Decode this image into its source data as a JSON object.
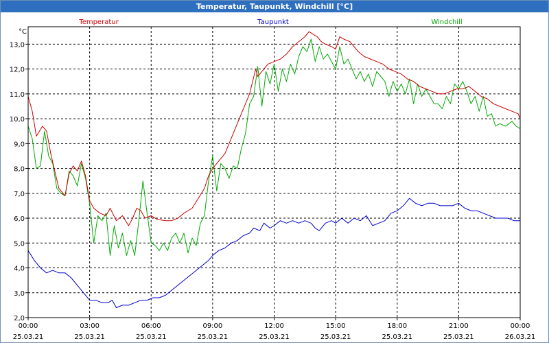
{
  "window": {
    "title": "Temperatur, Taupunkt, Windchill [°C]"
  },
  "chart_data": {
    "type": "line",
    "title": "Temperatur, Taupunkt, Windchill [°C]",
    "ylabel": "°C",
    "ylim": [
      2.0,
      13.7
    ],
    "yticks": [
      "2,0",
      "3,0",
      "4,0",
      "5,0",
      "6,0",
      "7,0",
      "8,0",
      "9,0",
      "10,0",
      "11,0",
      "12,0",
      "13,0"
    ],
    "yticks_values": [
      2,
      3,
      4,
      5,
      6,
      7,
      8,
      9,
      10,
      11,
      12,
      13
    ],
    "xlim_hours": [
      0,
      24
    ],
    "xticks": [
      {
        "time": "00:00",
        "date": "25.03.21",
        "hour": 0
      },
      {
        "time": "03:00",
        "date": "25.03.21",
        "hour": 3
      },
      {
        "time": "06:00",
        "date": "25.03.21",
        "hour": 6
      },
      {
        "time": "09:00",
        "date": "25.03.21",
        "hour": 9
      },
      {
        "time": "12:00",
        "date": "25.03.21",
        "hour": 12
      },
      {
        "time": "15:00",
        "date": "25.03.21",
        "hour": 15
      },
      {
        "time": "18:00",
        "date": "25.03.21",
        "hour": 18
      },
      {
        "time": "21:00",
        "date": "25.03.21",
        "hour": 21
      },
      {
        "time": "00:00",
        "date": "26.03.21",
        "hour": 24
      }
    ],
    "grid": true,
    "legend_position": "top",
    "series": [
      {
        "name": "Temperatur",
        "color": "#cc0000",
        "points": [
          [
            0,
            10.9
          ],
          [
            0.2,
            10.3
          ],
          [
            0.4,
            9.3
          ],
          [
            0.7,
            9.7
          ],
          [
            0.9,
            9.5
          ],
          [
            1.1,
            8.6
          ],
          [
            1.3,
            7.9
          ],
          [
            1.5,
            7.2
          ],
          [
            1.8,
            6.9
          ],
          [
            2.0,
            7.8
          ],
          [
            2.2,
            8.1
          ],
          [
            2.4,
            7.9
          ],
          [
            2.6,
            8.3
          ],
          [
            2.8,
            7.7
          ],
          [
            3.0,
            6.7
          ],
          [
            3.2,
            6.4
          ],
          [
            3.5,
            6.2
          ],
          [
            3.8,
            6.1
          ],
          [
            4.0,
            6.4
          ],
          [
            4.3,
            5.9
          ],
          [
            4.6,
            6.1
          ],
          [
            4.9,
            5.7
          ],
          [
            5.1,
            6.0
          ],
          [
            5.3,
            6.4
          ],
          [
            5.5,
            6.3
          ],
          [
            5.7,
            6.0
          ],
          [
            6.0,
            6.1
          ],
          [
            6.3,
            5.95
          ],
          [
            6.7,
            5.9
          ],
          [
            7.0,
            5.9
          ],
          [
            7.3,
            6.0
          ],
          [
            7.6,
            6.2
          ],
          [
            8.0,
            6.4
          ],
          [
            8.3,
            6.8
          ],
          [
            8.6,
            7.2
          ],
          [
            8.8,
            7.7
          ],
          [
            9.0,
            8.0
          ],
          [
            9.3,
            8.3
          ],
          [
            9.6,
            8.6
          ],
          [
            9.9,
            9.2
          ],
          [
            10.2,
            9.8
          ],
          [
            10.5,
            10.4
          ],
          [
            10.8,
            11.0
          ],
          [
            11.1,
            12.0
          ],
          [
            11.2,
            11.7
          ],
          [
            11.4,
            11.9
          ],
          [
            11.7,
            12.2
          ],
          [
            12.0,
            12.3
          ],
          [
            12.3,
            12.4
          ],
          [
            12.6,
            12.6
          ],
          [
            12.9,
            12.9
          ],
          [
            13.2,
            13.1
          ],
          [
            13.5,
            13.3
          ],
          [
            13.7,
            13.5
          ],
          [
            13.9,
            13.4
          ],
          [
            14.1,
            13.3
          ],
          [
            14.3,
            13.1
          ],
          [
            14.5,
            13.0
          ],
          [
            14.8,
            12.9
          ],
          [
            15.0,
            12.8
          ],
          [
            15.2,
            13.3
          ],
          [
            15.4,
            13.2
          ],
          [
            15.7,
            13.1
          ],
          [
            15.9,
            12.9
          ],
          [
            16.1,
            12.7
          ],
          [
            16.4,
            12.5
          ],
          [
            16.7,
            12.4
          ],
          [
            17.0,
            12.3
          ],
          [
            17.3,
            12.2
          ],
          [
            17.6,
            12.0
          ],
          [
            17.9,
            11.9
          ],
          [
            18.2,
            11.8
          ],
          [
            18.5,
            11.6
          ],
          [
            18.8,
            11.5
          ],
          [
            19.1,
            11.3
          ],
          [
            19.4,
            11.2
          ],
          [
            19.7,
            11.1
          ],
          [
            20.0,
            11.0
          ],
          [
            20.3,
            11.0
          ],
          [
            20.6,
            11.1
          ],
          [
            20.9,
            11.2
          ],
          [
            21.2,
            11.2
          ],
          [
            21.5,
            11.3
          ],
          [
            21.8,
            11.1
          ],
          [
            22.1,
            10.9
          ],
          [
            22.4,
            10.8
          ],
          [
            22.7,
            10.6
          ],
          [
            23.0,
            10.5
          ],
          [
            23.3,
            10.4
          ],
          [
            23.6,
            10.3
          ],
          [
            23.9,
            10.2
          ],
          [
            24.0,
            10.0
          ]
        ]
      },
      {
        "name": "Taupunkt",
        "color": "#0000cc",
        "points": [
          [
            0,
            4.7
          ],
          [
            0.3,
            4.3
          ],
          [
            0.6,
            4.0
          ],
          [
            0.9,
            3.8
          ],
          [
            1.2,
            3.9
          ],
          [
            1.5,
            3.8
          ],
          [
            1.8,
            3.8
          ],
          [
            2.1,
            3.6
          ],
          [
            2.4,
            3.3
          ],
          [
            2.7,
            3.0
          ],
          [
            3.0,
            2.7
          ],
          [
            3.3,
            2.7
          ],
          [
            3.6,
            2.6
          ],
          [
            3.9,
            2.6
          ],
          [
            4.1,
            2.7
          ],
          [
            4.3,
            2.4
          ],
          [
            4.6,
            2.5
          ],
          [
            4.9,
            2.5
          ],
          [
            5.2,
            2.6
          ],
          [
            5.5,
            2.7
          ],
          [
            5.8,
            2.7
          ],
          [
            6.1,
            2.8
          ],
          [
            6.4,
            2.8
          ],
          [
            6.7,
            2.9
          ],
          [
            7.0,
            3.1
          ],
          [
            7.3,
            3.3
          ],
          [
            7.6,
            3.5
          ],
          [
            7.9,
            3.7
          ],
          [
            8.2,
            3.9
          ],
          [
            8.5,
            4.1
          ],
          [
            8.8,
            4.3
          ],
          [
            9.0,
            4.5
          ],
          [
            9.3,
            4.7
          ],
          [
            9.6,
            4.8
          ],
          [
            9.9,
            5.0
          ],
          [
            10.2,
            5.1
          ],
          [
            10.5,
            5.3
          ],
          [
            10.8,
            5.4
          ],
          [
            11.0,
            5.6
          ],
          [
            11.3,
            5.5
          ],
          [
            11.5,
            5.8
          ],
          [
            11.8,
            5.6
          ],
          [
            12.0,
            5.7
          ],
          [
            12.3,
            5.9
          ],
          [
            12.6,
            5.8
          ],
          [
            12.9,
            5.9
          ],
          [
            13.2,
            5.8
          ],
          [
            13.5,
            5.9
          ],
          [
            13.8,
            5.8
          ],
          [
            14.0,
            5.6
          ],
          [
            14.2,
            5.5
          ],
          [
            14.5,
            5.8
          ],
          [
            14.8,
            5.9
          ],
          [
            15.0,
            5.8
          ],
          [
            15.3,
            6.0
          ],
          [
            15.6,
            5.8
          ],
          [
            15.9,
            6.0
          ],
          [
            16.2,
            5.9
          ],
          [
            16.5,
            6.1
          ],
          [
            16.8,
            5.7
          ],
          [
            17.1,
            5.8
          ],
          [
            17.4,
            5.9
          ],
          [
            17.7,
            6.2
          ],
          [
            18.0,
            6.3
          ],
          [
            18.3,
            6.5
          ],
          [
            18.6,
            6.8
          ],
          [
            18.9,
            6.6
          ],
          [
            19.2,
            6.5
          ],
          [
            19.5,
            6.6
          ],
          [
            19.8,
            6.6
          ],
          [
            20.1,
            6.5
          ],
          [
            20.4,
            6.5
          ],
          [
            20.7,
            6.5
          ],
          [
            21.0,
            6.6
          ],
          [
            21.3,
            6.4
          ],
          [
            21.6,
            6.3
          ],
          [
            21.9,
            6.3
          ],
          [
            22.2,
            6.2
          ],
          [
            22.5,
            6.1
          ],
          [
            22.8,
            6.0
          ],
          [
            23.1,
            6.0
          ],
          [
            23.4,
            6.0
          ],
          [
            23.7,
            5.9
          ],
          [
            24.0,
            5.9
          ]
        ]
      },
      {
        "name": "Windchill",
        "color": "#00aa00",
        "points": [
          [
            0,
            9.7
          ],
          [
            0.2,
            9.2
          ],
          [
            0.4,
            8.0
          ],
          [
            0.6,
            8.1
          ],
          [
            0.8,
            9.5
          ],
          [
            1.0,
            8.5
          ],
          [
            1.2,
            8.2
          ],
          [
            1.4,
            7.2
          ],
          [
            1.6,
            7.0
          ],
          [
            1.8,
            6.9
          ],
          [
            2.0,
            7.9
          ],
          [
            2.2,
            7.7
          ],
          [
            2.4,
            7.3
          ],
          [
            2.6,
            8.2
          ],
          [
            2.8,
            7.6
          ],
          [
            3.0,
            6.6
          ],
          [
            3.2,
            5.0
          ],
          [
            3.4,
            6.1
          ],
          [
            3.6,
            5.9
          ],
          [
            3.8,
            6.2
          ],
          [
            4.0,
            4.5
          ],
          [
            4.2,
            5.7
          ],
          [
            4.4,
            4.8
          ],
          [
            4.6,
            5.4
          ],
          [
            4.8,
            4.5
          ],
          [
            5.0,
            5.1
          ],
          [
            5.2,
            4.5
          ],
          [
            5.4,
            5.9
          ],
          [
            5.6,
            7.5
          ],
          [
            5.8,
            6.2
          ],
          [
            6.0,
            5.0
          ],
          [
            6.2,
            4.9
          ],
          [
            6.4,
            4.7
          ],
          [
            6.6,
            5.0
          ],
          [
            6.8,
            4.7
          ],
          [
            7.0,
            5.2
          ],
          [
            7.2,
            5.4
          ],
          [
            7.4,
            5.0
          ],
          [
            7.6,
            5.4
          ],
          [
            7.8,
            4.6
          ],
          [
            8.0,
            5.2
          ],
          [
            8.2,
            4.9
          ],
          [
            8.4,
            5.8
          ],
          [
            8.6,
            6.1
          ],
          [
            8.8,
            7.5
          ],
          [
            9.0,
            8.5
          ],
          [
            9.2,
            7.1
          ],
          [
            9.4,
            8.2
          ],
          [
            9.6,
            8.0
          ],
          [
            9.8,
            7.6
          ],
          [
            10.0,
            8.1
          ],
          [
            10.2,
            8.0
          ],
          [
            10.4,
            8.8
          ],
          [
            10.6,
            9.4
          ],
          [
            10.8,
            10.6
          ],
          [
            11.0,
            10.9
          ],
          [
            11.2,
            12.1
          ],
          [
            11.4,
            10.5
          ],
          [
            11.6,
            11.9
          ],
          [
            11.8,
            11.4
          ],
          [
            12.0,
            12.2
          ],
          [
            12.2,
            11.1
          ],
          [
            12.4,
            12.0
          ],
          [
            12.6,
            11.5
          ],
          [
            12.8,
            12.2
          ],
          [
            13.0,
            11.8
          ],
          [
            13.2,
            12.5
          ],
          [
            13.4,
            12.9
          ],
          [
            13.6,
            12.7
          ],
          [
            13.8,
            13.2
          ],
          [
            14.0,
            12.3
          ],
          [
            14.2,
            12.9
          ],
          [
            14.4,
            12.4
          ],
          [
            14.6,
            12.6
          ],
          [
            14.8,
            12.3
          ],
          [
            15.0,
            12.0
          ],
          [
            15.2,
            12.9
          ],
          [
            15.4,
            12.2
          ],
          [
            15.6,
            12.4
          ],
          [
            15.8,
            12.0
          ],
          [
            16.0,
            11.6
          ],
          [
            16.2,
            11.9
          ],
          [
            16.4,
            11.5
          ],
          [
            16.6,
            11.8
          ],
          [
            16.8,
            11.3
          ],
          [
            17.0,
            11.9
          ],
          [
            17.2,
            11.7
          ],
          [
            17.4,
            11.5
          ],
          [
            17.6,
            10.9
          ],
          [
            17.8,
            11.5
          ],
          [
            18.0,
            11.1
          ],
          [
            18.2,
            11.4
          ],
          [
            18.4,
            11.0
          ],
          [
            18.6,
            11.6
          ],
          [
            18.8,
            10.6
          ],
          [
            19.0,
            11.4
          ],
          [
            19.2,
            10.9
          ],
          [
            19.4,
            11.2
          ],
          [
            19.6,
            10.9
          ],
          [
            19.8,
            10.6
          ],
          [
            20.0,
            10.6
          ],
          [
            20.2,
            10.4
          ],
          [
            20.4,
            10.9
          ],
          [
            20.6,
            10.6
          ],
          [
            20.8,
            11.4
          ],
          [
            21.0,
            11.2
          ],
          [
            21.2,
            11.5
          ],
          [
            21.4,
            11.1
          ],
          [
            21.6,
            10.6
          ],
          [
            21.8,
            10.9
          ],
          [
            22.0,
            10.3
          ],
          [
            22.2,
            10.9
          ],
          [
            22.4,
            10.1
          ],
          [
            22.6,
            10.2
          ],
          [
            22.8,
            9.7
          ],
          [
            23.0,
            9.8
          ],
          [
            23.3,
            9.7
          ],
          [
            23.6,
            9.9
          ],
          [
            23.8,
            9.7
          ],
          [
            24.0,
            9.6
          ]
        ]
      }
    ]
  }
}
